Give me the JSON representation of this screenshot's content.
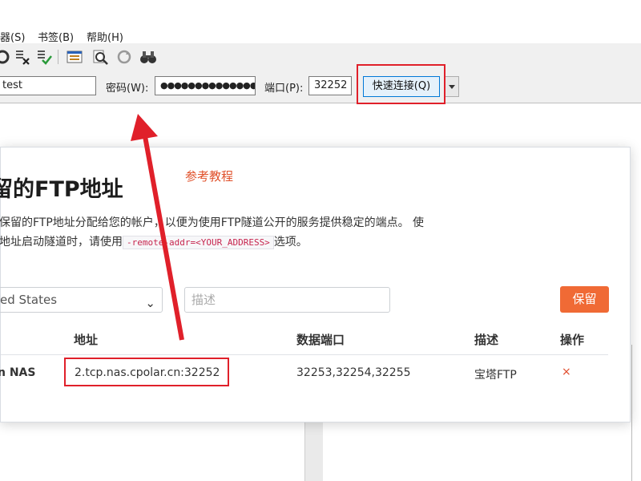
{
  "menu": {
    "items": [
      "器(S)",
      "书签(B)",
      "帮助(H)"
    ]
  },
  "toolbar": {
    "icons": [
      "refresh-icon",
      "cancel-queue-icon",
      "process-queue-icon",
      "log-toggle-icon",
      "search-files-icon",
      "reconnect-icon",
      "find-binoculars-icon"
    ]
  },
  "quickconnect": {
    "username_value": "test",
    "password_label": "密码(W):",
    "password_value": "●●●●●●●●●●●●●●",
    "port_label": "端口(P):",
    "port_value": "32252",
    "connect_label": "快速连接(Q)"
  },
  "dialog": {
    "title": "留的FTP地址",
    "ref_link": "参考教程",
    "desc_line1": "保留的FTP地址分配给您的帐户，以便为使用FTP隧道公开的服务提供稳定的端点。 使",
    "desc_line2_pre": "地址启动隧道时，请使用",
    "desc_code": "-remote-addr=<YOUR_ADDRESS>",
    "desc_line2_post": "选项。",
    "region_value": "ed States",
    "desc_placeholder": "描述",
    "reserve_label": "保留",
    "columns": {
      "address": "地址",
      "data_ports": "数据端口",
      "description": "描述",
      "actions": "操作"
    },
    "rows": [
      {
        "region": "n NAS",
        "address": "2.tcp.nas.cpolar.cn:32252",
        "data_ports": "32253,32254,32255",
        "description": "宝塔FTP",
        "delete": "×"
      }
    ]
  },
  "colors": {
    "accent_orange": "#f06a35",
    "highlight_red": "#e0202a",
    "link_orange": "#e0502a"
  }
}
